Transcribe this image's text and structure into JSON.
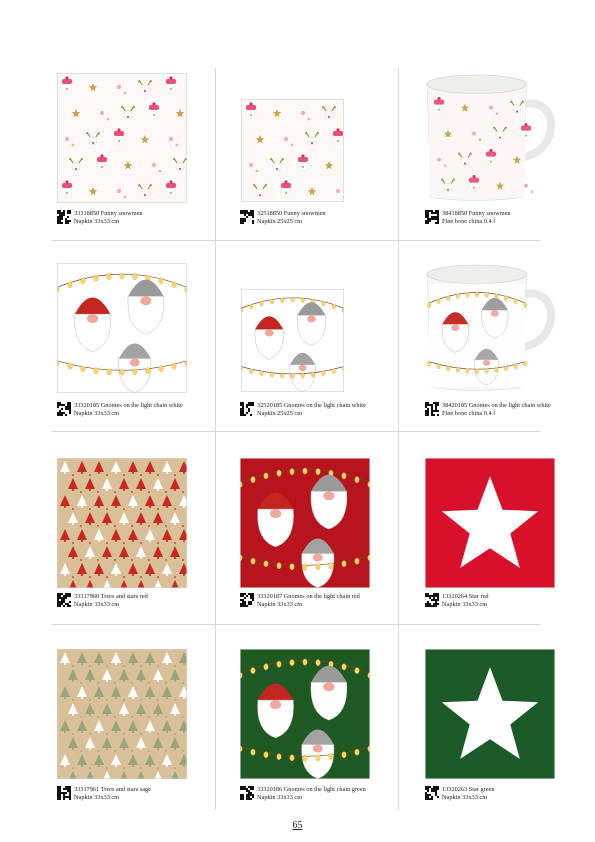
{
  "products": [
    {
      "code_title": "33318850 Funny snowmen",
      "detail": "Napkin 33x33 cm",
      "design": "snowmen",
      "kind": "napkin33"
    },
    {
      "code_title": "32518850 Funny snowmen",
      "detail": "Napkin 25x25 cm",
      "design": "snowmen",
      "kind": "napkin25"
    },
    {
      "code_title": "38418850 Funny snowmen",
      "detail": "Fine bone china 0.4 l",
      "design": "snowmen",
      "kind": "mug"
    },
    {
      "code_title": "33320185 Gnomes on the light chain white",
      "detail": "Napkin 33x33 cm",
      "design": "gnomes-white",
      "kind": "napkin33"
    },
    {
      "code_title": "32520185 Gnomes on the light chain white",
      "detail": "Napkin 25x25 cm",
      "design": "gnomes-white",
      "kind": "napkin25"
    },
    {
      "code_title": "38420185 Gnomes on the light chain white",
      "detail": "Fine bone china 0.4 l",
      "design": "gnomes-white",
      "kind": "mug"
    },
    {
      "code_title": "33317960 Trees and stars red",
      "detail": "Napkin 33x33 cm",
      "design": "trees-red",
      "kind": "napkin33"
    },
    {
      "code_title": "33320187 Gnomes on the light chain red",
      "detail": "Napkin 33x33 cm",
      "design": "gnomes-red",
      "kind": "napkin33"
    },
    {
      "code_title": "13320264 Star red",
      "detail": "Napkin 33x33 cm",
      "design": "star-red",
      "kind": "napkin33"
    },
    {
      "code_title": "33317961 Trees and stars sage",
      "detail": "Napkin 33x33 cm",
      "design": "trees-sage",
      "kind": "napkin33"
    },
    {
      "code_title": "33320186 Gnomes on the light chain green",
      "detail": "Napkin 33x33 cm",
      "design": "gnomes-green",
      "kind": "napkin33"
    },
    {
      "code_title": "13320263 Star green",
      "detail": "Napkin 33x33 cm",
      "design": "star-green",
      "kind": "napkin33"
    }
  ],
  "colors": {
    "star_red": "#d8102a",
    "star_green": "#1d5a2a",
    "kraft": "#dcc29a",
    "gnome_red_bg": "#b7141e",
    "gnome_green_bg": "#1f5a22"
  },
  "page_number": "65"
}
